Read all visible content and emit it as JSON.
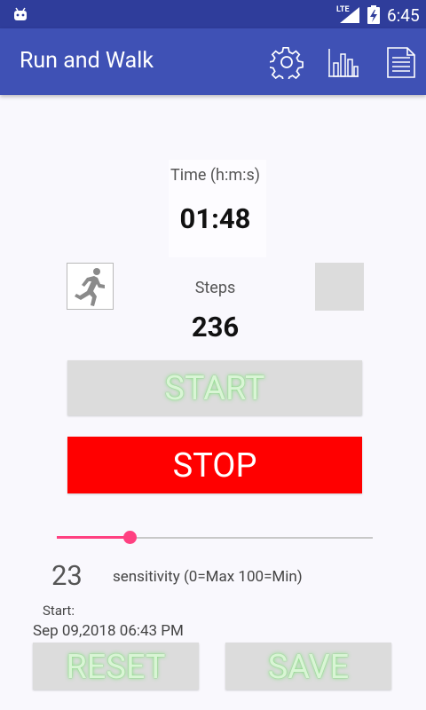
{
  "status_bar": {
    "network": "LTE",
    "time": "6:45",
    "icons": [
      "android-notification-icon",
      "signal-icon",
      "battery-charging-icon"
    ]
  },
  "app_bar": {
    "title": "Run and Walk",
    "actions": [
      "settings-gear-icon",
      "bar-chart-icon",
      "document-list-icon"
    ]
  },
  "timer": {
    "label": "Time (h:m:s)",
    "value": "01:48"
  },
  "steps": {
    "label": "Steps",
    "value": "236"
  },
  "buttons": {
    "start": "START",
    "stop": "STOP",
    "reset": "RESET",
    "save": "SAVE"
  },
  "sensitivity": {
    "value": "23",
    "label": "sensitivity (0=Max 100=Min)",
    "slider_percent": 23
  },
  "session": {
    "start_label": "Start:",
    "start_datetime": "Sep 09,2018 06:43 PM"
  },
  "colors": {
    "app_bar": "#3f51b5",
    "status_bar": "#2f3d9b",
    "stop_button": "#ff0000",
    "slider_accent": "#ff4081",
    "button_text_glow": "#7ee07a"
  }
}
